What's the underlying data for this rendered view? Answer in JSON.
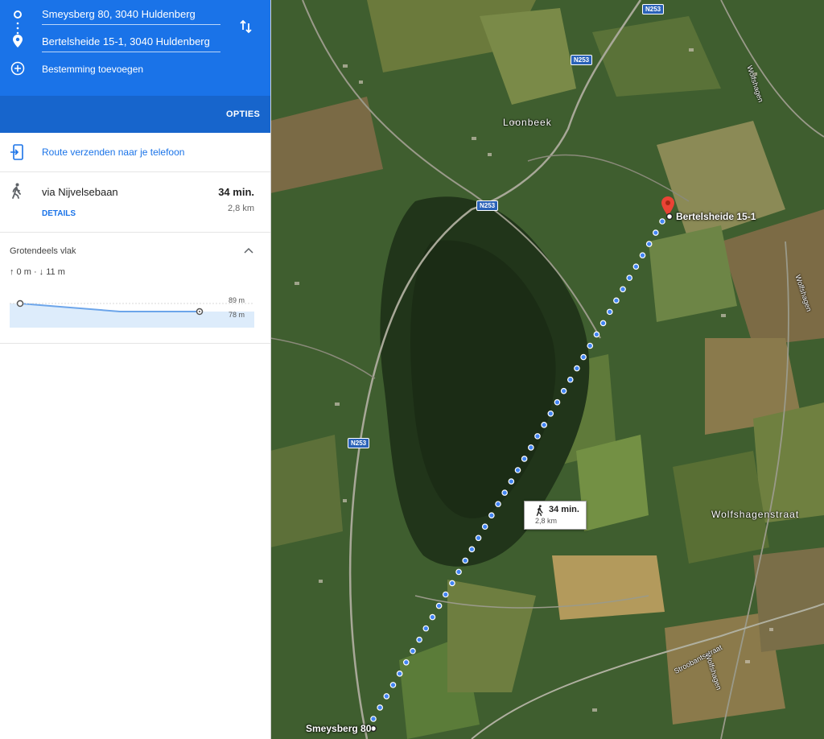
{
  "directions": {
    "origin": "Smeysberg 80, 3040 Huldenberg",
    "destination": "Bertelsheide 15-1, 3040 Huldenberg",
    "add_destination": "Bestemming toevoegen",
    "options_label": "OPTIES",
    "send_to_phone": "Route verzenden naar je telefoon"
  },
  "route": {
    "via": "via Nijvelsebaan",
    "duration": "34 min.",
    "distance": "2,8 km",
    "details_label": "DETAILS"
  },
  "elevation": {
    "title": "Grotendeels vlak",
    "summary": "↑ 0 m · ↓ 11 m",
    "max_label": "89 m",
    "min_label": "78 m",
    "profile": [
      89,
      78,
      78
    ]
  },
  "map": {
    "place_labels": [
      "Loonbeek",
      "Wolfshagenstraat"
    ],
    "street_labels": [
      "Wolfshagen",
      "Wolfshagen",
      "Stroobantsstraat",
      "Wolfshagen"
    ],
    "road_shields": [
      "N253",
      "N253",
      "N253",
      "N253"
    ],
    "destination_label": "Bertelsheide 15-1",
    "origin_label": "Smeysberg 80",
    "route_duration": "34 min.",
    "route_distance": "2,8 km"
  },
  "colors": {
    "header_blue": "#1a73e8",
    "route_dot": "#4285f4",
    "pin_red": "#ea4335",
    "link_blue": "#1a73e8"
  }
}
